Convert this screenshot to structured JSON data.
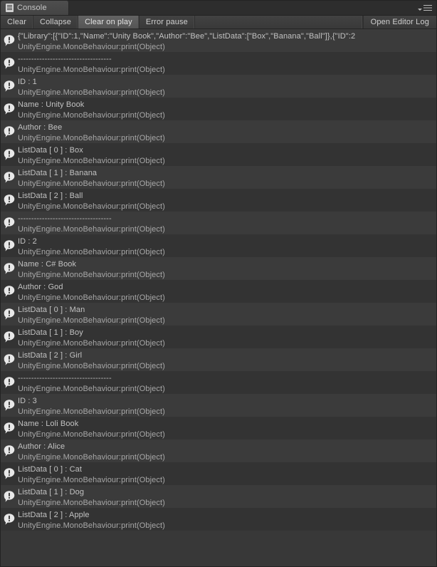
{
  "window": {
    "tab_label": "Console",
    "tab_icon": "console-icon",
    "menu_icon": "hamburger-menu-icon",
    "caret_icon": "chevron-down-icon"
  },
  "toolbar": {
    "clear_label": "Clear",
    "collapse_label": "Collapse",
    "clear_on_play_label": "Clear on play",
    "error_pause_label": "Error pause",
    "open_editor_log_label": "Open Editor Log",
    "active_button": "Clear on play"
  },
  "log": {
    "icon_name": "log-message-icon",
    "stack_trace": "UnityEngine.MonoBehaviour:print(Object)",
    "separator": "-----------------------------------",
    "entries": [
      {
        "message": "{\"Library\":[{\"ID\":1,\"Name\":\"Unity Book\",\"Author\":\"Bee\",\"ListData\":[\"Box\",\"Banana\",\"Ball\"]},{\"ID\":2"
      },
      {
        "message": "-----------------------------------"
      },
      {
        "message": "ID : 1"
      },
      {
        "message": "Name : Unity Book"
      },
      {
        "message": "Author : Bee"
      },
      {
        "message": "ListData [ 0 ] : Box"
      },
      {
        "message": "ListData [ 1 ] : Banana"
      },
      {
        "message": "ListData [ 2 ] : Ball"
      },
      {
        "message": "-----------------------------------"
      },
      {
        "message": "ID : 2"
      },
      {
        "message": "Name : C# Book"
      },
      {
        "message": "Author : God"
      },
      {
        "message": "ListData [ 0 ] : Man"
      },
      {
        "message": "ListData [ 1 ] : Boy"
      },
      {
        "message": "ListData [ 2 ] : Girl"
      },
      {
        "message": "-----------------------------------"
      },
      {
        "message": "ID : 3"
      },
      {
        "message": "Name : Loli Book"
      },
      {
        "message": "Author : Alice"
      },
      {
        "message": "ListData [ 0 ] : Cat"
      },
      {
        "message": "ListData [ 1 ] : Dog"
      },
      {
        "message": "ListData [ 2 ] : Apple"
      }
    ]
  },
  "colors": {
    "panel_background": "#383838",
    "row_background": "#3b3b3b",
    "row_background_alt": "#333333",
    "toolbar_background": "#3c3c3c",
    "active_button": "#5b5b5b",
    "text_primary": "#c2c2c2",
    "text_secondary": "#a8a8a8"
  }
}
